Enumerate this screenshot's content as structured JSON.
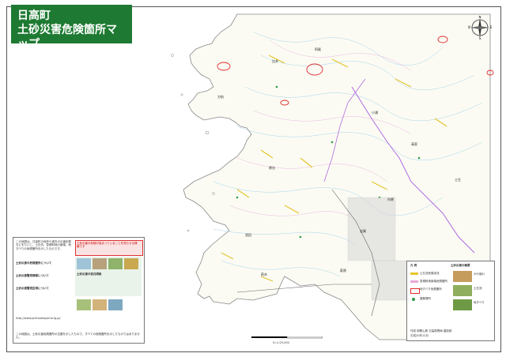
{
  "title": {
    "line1": "日高町",
    "line2": "土砂災害危険箇所マップ"
  },
  "compass": {
    "n": "N",
    "s": "S",
    "e": "E",
    "w": "W"
  },
  "left_panel": {
    "intro": "この地図は、日高町の地形や過去の災害記録などをもとに、土石流、急傾斜地の崩壊、地すべりの危険箇所を示したものです。",
    "head1": "土砂災害の危険箇所について",
    "head2": "土砂災害警戒情報について",
    "head3": "土砂災害の前兆現象",
    "head4": "土砂災害警戒区域について",
    "warning_box": "土砂災害の危険が高まっていることを知らせる情報です",
    "url": "http://www.pref.wakayama.lg.jp/",
    "footer_note": "この地図は、土砂災害危険箇所の位置を示したもので、すべての危険箇所を示したものではありません。"
  },
  "legend": {
    "title": "凡 例",
    "summary_title": "土砂災害の概要",
    "item1": "土石流危険渓流",
    "item2": "急傾斜地崩壊危険箇所",
    "item3": "地すべり危険箇所",
    "item4": "避難場所",
    "type1": "がけ崩れ",
    "type2": "土石流",
    "type3": "地すべり",
    "credit": "作成 和歌山県 日高振興局 建設部",
    "date": "平成20年12月"
  },
  "scale_label": "S=1:25,000",
  "place_labels": [
    "比井",
    "阿尾",
    "方杭",
    "小浦",
    "原谷",
    "高家",
    "池田",
    "志賀",
    "荊木",
    "萩原",
    "内原",
    "土生"
  ]
}
